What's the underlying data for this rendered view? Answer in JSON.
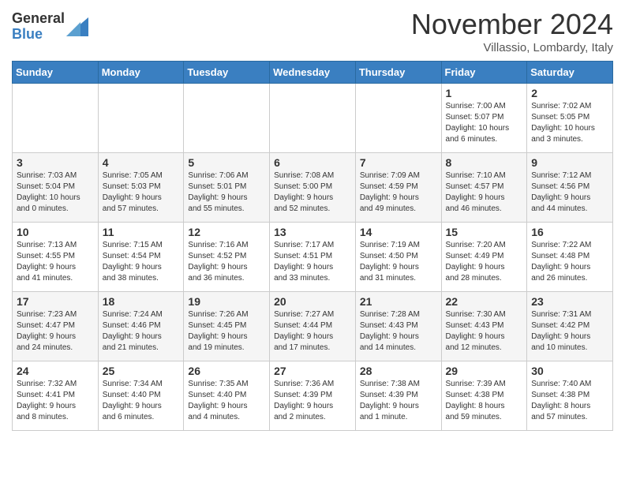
{
  "header": {
    "logo_general": "General",
    "logo_blue": "Blue",
    "title": "November 2024",
    "location": "Villassio, Lombardy, Italy"
  },
  "days_of_week": [
    "Sunday",
    "Monday",
    "Tuesday",
    "Wednesday",
    "Thursday",
    "Friday",
    "Saturday"
  ],
  "weeks": [
    [
      {
        "day": "",
        "info": ""
      },
      {
        "day": "",
        "info": ""
      },
      {
        "day": "",
        "info": ""
      },
      {
        "day": "",
        "info": ""
      },
      {
        "day": "",
        "info": ""
      },
      {
        "day": "1",
        "info": "Sunrise: 7:00 AM\nSunset: 5:07 PM\nDaylight: 10 hours\nand 6 minutes."
      },
      {
        "day": "2",
        "info": "Sunrise: 7:02 AM\nSunset: 5:05 PM\nDaylight: 10 hours\nand 3 minutes."
      }
    ],
    [
      {
        "day": "3",
        "info": "Sunrise: 7:03 AM\nSunset: 5:04 PM\nDaylight: 10 hours\nand 0 minutes."
      },
      {
        "day": "4",
        "info": "Sunrise: 7:05 AM\nSunset: 5:03 PM\nDaylight: 9 hours\nand 57 minutes."
      },
      {
        "day": "5",
        "info": "Sunrise: 7:06 AM\nSunset: 5:01 PM\nDaylight: 9 hours\nand 55 minutes."
      },
      {
        "day": "6",
        "info": "Sunrise: 7:08 AM\nSunset: 5:00 PM\nDaylight: 9 hours\nand 52 minutes."
      },
      {
        "day": "7",
        "info": "Sunrise: 7:09 AM\nSunset: 4:59 PM\nDaylight: 9 hours\nand 49 minutes."
      },
      {
        "day": "8",
        "info": "Sunrise: 7:10 AM\nSunset: 4:57 PM\nDaylight: 9 hours\nand 46 minutes."
      },
      {
        "day": "9",
        "info": "Sunrise: 7:12 AM\nSunset: 4:56 PM\nDaylight: 9 hours\nand 44 minutes."
      }
    ],
    [
      {
        "day": "10",
        "info": "Sunrise: 7:13 AM\nSunset: 4:55 PM\nDaylight: 9 hours\nand 41 minutes."
      },
      {
        "day": "11",
        "info": "Sunrise: 7:15 AM\nSunset: 4:54 PM\nDaylight: 9 hours\nand 38 minutes."
      },
      {
        "day": "12",
        "info": "Sunrise: 7:16 AM\nSunset: 4:52 PM\nDaylight: 9 hours\nand 36 minutes."
      },
      {
        "day": "13",
        "info": "Sunrise: 7:17 AM\nSunset: 4:51 PM\nDaylight: 9 hours\nand 33 minutes."
      },
      {
        "day": "14",
        "info": "Sunrise: 7:19 AM\nSunset: 4:50 PM\nDaylight: 9 hours\nand 31 minutes."
      },
      {
        "day": "15",
        "info": "Sunrise: 7:20 AM\nSunset: 4:49 PM\nDaylight: 9 hours\nand 28 minutes."
      },
      {
        "day": "16",
        "info": "Sunrise: 7:22 AM\nSunset: 4:48 PM\nDaylight: 9 hours\nand 26 minutes."
      }
    ],
    [
      {
        "day": "17",
        "info": "Sunrise: 7:23 AM\nSunset: 4:47 PM\nDaylight: 9 hours\nand 24 minutes."
      },
      {
        "day": "18",
        "info": "Sunrise: 7:24 AM\nSunset: 4:46 PM\nDaylight: 9 hours\nand 21 minutes."
      },
      {
        "day": "19",
        "info": "Sunrise: 7:26 AM\nSunset: 4:45 PM\nDaylight: 9 hours\nand 19 minutes."
      },
      {
        "day": "20",
        "info": "Sunrise: 7:27 AM\nSunset: 4:44 PM\nDaylight: 9 hours\nand 17 minutes."
      },
      {
        "day": "21",
        "info": "Sunrise: 7:28 AM\nSunset: 4:43 PM\nDaylight: 9 hours\nand 14 minutes."
      },
      {
        "day": "22",
        "info": "Sunrise: 7:30 AM\nSunset: 4:43 PM\nDaylight: 9 hours\nand 12 minutes."
      },
      {
        "day": "23",
        "info": "Sunrise: 7:31 AM\nSunset: 4:42 PM\nDaylight: 9 hours\nand 10 minutes."
      }
    ],
    [
      {
        "day": "24",
        "info": "Sunrise: 7:32 AM\nSunset: 4:41 PM\nDaylight: 9 hours\nand 8 minutes."
      },
      {
        "day": "25",
        "info": "Sunrise: 7:34 AM\nSunset: 4:40 PM\nDaylight: 9 hours\nand 6 minutes."
      },
      {
        "day": "26",
        "info": "Sunrise: 7:35 AM\nSunset: 4:40 PM\nDaylight: 9 hours\nand 4 minutes."
      },
      {
        "day": "27",
        "info": "Sunrise: 7:36 AM\nSunset: 4:39 PM\nDaylight: 9 hours\nand 2 minutes."
      },
      {
        "day": "28",
        "info": "Sunrise: 7:38 AM\nSunset: 4:39 PM\nDaylight: 9 hours\nand 1 minute."
      },
      {
        "day": "29",
        "info": "Sunrise: 7:39 AM\nSunset: 4:38 PM\nDaylight: 8 hours\nand 59 minutes."
      },
      {
        "day": "30",
        "info": "Sunrise: 7:40 AM\nSunset: 4:38 PM\nDaylight: 8 hours\nand 57 minutes."
      }
    ]
  ]
}
